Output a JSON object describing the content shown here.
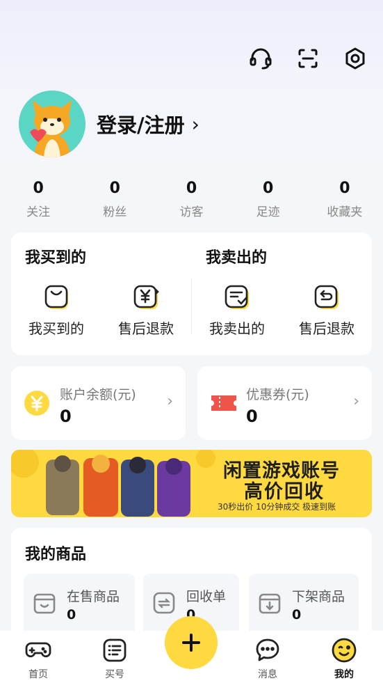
{
  "header": {
    "icons": [
      "headset-icon",
      "scan-icon",
      "settings-icon"
    ]
  },
  "profile": {
    "login_label": "登录/注册",
    "chevron": "›"
  },
  "stats": [
    {
      "value": "0",
      "label": "关注"
    },
    {
      "value": "0",
      "label": "粉丝"
    },
    {
      "value": "0",
      "label": "访客"
    },
    {
      "value": "0",
      "label": "足迹"
    },
    {
      "value": "0",
      "label": "收藏夹"
    }
  ],
  "orders": {
    "bought": {
      "title": "我买到的",
      "items": [
        {
          "label": "我买到的",
          "icon": "shopping-bag-icon"
        },
        {
          "label": "售后退款",
          "icon": "yuan-refund-icon"
        }
      ]
    },
    "sold": {
      "title": "我卖出的",
      "items": [
        {
          "label": "我卖出的",
          "icon": "sold-list-icon"
        },
        {
          "label": "售后退款",
          "icon": "return-icon"
        }
      ]
    }
  },
  "wallet": {
    "balance": {
      "label": "账户余额(元)",
      "value": "0"
    },
    "coupon": {
      "label": "优惠券(元)",
      "value": "0"
    }
  },
  "banner": {
    "line1": "闲置游戏账号",
    "line2": "高价回收",
    "line3": "30秒出价 10分钟成交 极速到账"
  },
  "goods": {
    "title": "我的商品",
    "tiles": [
      {
        "label": "在售商品",
        "count": "0"
      },
      {
        "label": "回收单",
        "count": "0"
      },
      {
        "label": "下架商品",
        "count": "0"
      }
    ]
  },
  "tabbar": {
    "tabs": [
      {
        "label": "首页"
      },
      {
        "label": "买号"
      },
      {
        "label": "消息"
      },
      {
        "label": "我的"
      }
    ],
    "fab": "+"
  },
  "colors": {
    "accent": "#fed940",
    "coupon": "#f0534a"
  }
}
